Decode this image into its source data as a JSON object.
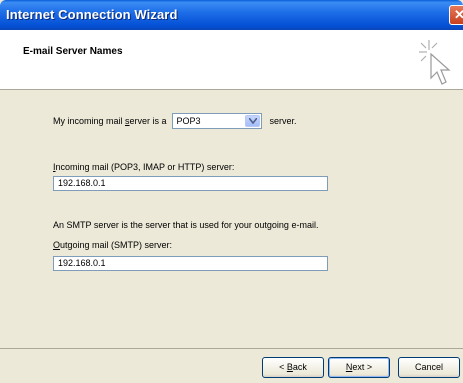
{
  "window": {
    "title": "Internet Connection Wizard"
  },
  "header": {
    "title": "E-mail Server Names"
  },
  "form": {
    "incoming_server_prefix": "My incoming mail server is a",
    "incoming_server_prefix_underlined": "s",
    "server_type_value": "POP3",
    "incoming_server_suffix": "server.",
    "incoming_label": "Incoming mail (POP3, IMAP or HTTP) server:",
    "incoming_value": "192.168.0.1",
    "smtp_note": "An SMTP server is the server that is used for your outgoing e-mail.",
    "outgoing_label": "Outgoing mail (SMTP) server:",
    "outgoing_value": "192.168.0.1"
  },
  "buttons": {
    "back": "Back",
    "next": "Next >",
    "cancel": "Cancel"
  },
  "icons": {
    "close": "close-icon",
    "dropdown": "chevron-down-icon",
    "wizard": "wizard-cursor-icon"
  }
}
